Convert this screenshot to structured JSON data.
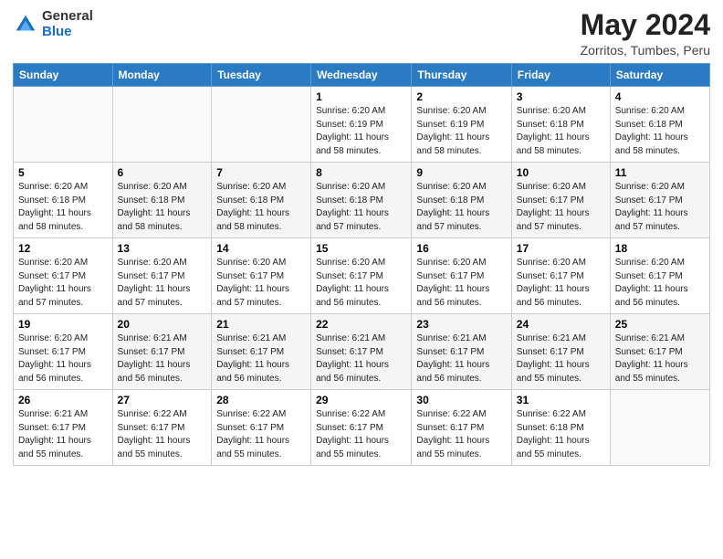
{
  "header": {
    "logo_general": "General",
    "logo_blue": "Blue",
    "title": "May 2024",
    "location": "Zorritos, Tumbes, Peru"
  },
  "days_of_week": [
    "Sunday",
    "Monday",
    "Tuesday",
    "Wednesday",
    "Thursday",
    "Friday",
    "Saturday"
  ],
  "weeks": [
    [
      {
        "day": "",
        "info": ""
      },
      {
        "day": "",
        "info": ""
      },
      {
        "day": "",
        "info": ""
      },
      {
        "day": "1",
        "info": "Sunrise: 6:20 AM\nSunset: 6:19 PM\nDaylight: 11 hours\nand 58 minutes."
      },
      {
        "day": "2",
        "info": "Sunrise: 6:20 AM\nSunset: 6:19 PM\nDaylight: 11 hours\nand 58 minutes."
      },
      {
        "day": "3",
        "info": "Sunrise: 6:20 AM\nSunset: 6:18 PM\nDaylight: 11 hours\nand 58 minutes."
      },
      {
        "day": "4",
        "info": "Sunrise: 6:20 AM\nSunset: 6:18 PM\nDaylight: 11 hours\nand 58 minutes."
      }
    ],
    [
      {
        "day": "5",
        "info": "Sunrise: 6:20 AM\nSunset: 6:18 PM\nDaylight: 11 hours\nand 58 minutes."
      },
      {
        "day": "6",
        "info": "Sunrise: 6:20 AM\nSunset: 6:18 PM\nDaylight: 11 hours\nand 58 minutes."
      },
      {
        "day": "7",
        "info": "Sunrise: 6:20 AM\nSunset: 6:18 PM\nDaylight: 11 hours\nand 58 minutes."
      },
      {
        "day": "8",
        "info": "Sunrise: 6:20 AM\nSunset: 6:18 PM\nDaylight: 11 hours\nand 57 minutes."
      },
      {
        "day": "9",
        "info": "Sunrise: 6:20 AM\nSunset: 6:18 PM\nDaylight: 11 hours\nand 57 minutes."
      },
      {
        "day": "10",
        "info": "Sunrise: 6:20 AM\nSunset: 6:17 PM\nDaylight: 11 hours\nand 57 minutes."
      },
      {
        "day": "11",
        "info": "Sunrise: 6:20 AM\nSunset: 6:17 PM\nDaylight: 11 hours\nand 57 minutes."
      }
    ],
    [
      {
        "day": "12",
        "info": "Sunrise: 6:20 AM\nSunset: 6:17 PM\nDaylight: 11 hours\nand 57 minutes."
      },
      {
        "day": "13",
        "info": "Sunrise: 6:20 AM\nSunset: 6:17 PM\nDaylight: 11 hours\nand 57 minutes."
      },
      {
        "day": "14",
        "info": "Sunrise: 6:20 AM\nSunset: 6:17 PM\nDaylight: 11 hours\nand 57 minutes."
      },
      {
        "day": "15",
        "info": "Sunrise: 6:20 AM\nSunset: 6:17 PM\nDaylight: 11 hours\nand 56 minutes."
      },
      {
        "day": "16",
        "info": "Sunrise: 6:20 AM\nSunset: 6:17 PM\nDaylight: 11 hours\nand 56 minutes."
      },
      {
        "day": "17",
        "info": "Sunrise: 6:20 AM\nSunset: 6:17 PM\nDaylight: 11 hours\nand 56 minutes."
      },
      {
        "day": "18",
        "info": "Sunrise: 6:20 AM\nSunset: 6:17 PM\nDaylight: 11 hours\nand 56 minutes."
      }
    ],
    [
      {
        "day": "19",
        "info": "Sunrise: 6:20 AM\nSunset: 6:17 PM\nDaylight: 11 hours\nand 56 minutes."
      },
      {
        "day": "20",
        "info": "Sunrise: 6:21 AM\nSunset: 6:17 PM\nDaylight: 11 hours\nand 56 minutes."
      },
      {
        "day": "21",
        "info": "Sunrise: 6:21 AM\nSunset: 6:17 PM\nDaylight: 11 hours\nand 56 minutes."
      },
      {
        "day": "22",
        "info": "Sunrise: 6:21 AM\nSunset: 6:17 PM\nDaylight: 11 hours\nand 56 minutes."
      },
      {
        "day": "23",
        "info": "Sunrise: 6:21 AM\nSunset: 6:17 PM\nDaylight: 11 hours\nand 56 minutes."
      },
      {
        "day": "24",
        "info": "Sunrise: 6:21 AM\nSunset: 6:17 PM\nDaylight: 11 hours\nand 55 minutes."
      },
      {
        "day": "25",
        "info": "Sunrise: 6:21 AM\nSunset: 6:17 PM\nDaylight: 11 hours\nand 55 minutes."
      }
    ],
    [
      {
        "day": "26",
        "info": "Sunrise: 6:21 AM\nSunset: 6:17 PM\nDaylight: 11 hours\nand 55 minutes."
      },
      {
        "day": "27",
        "info": "Sunrise: 6:22 AM\nSunset: 6:17 PM\nDaylight: 11 hours\nand 55 minutes."
      },
      {
        "day": "28",
        "info": "Sunrise: 6:22 AM\nSunset: 6:17 PM\nDaylight: 11 hours\nand 55 minutes."
      },
      {
        "day": "29",
        "info": "Sunrise: 6:22 AM\nSunset: 6:17 PM\nDaylight: 11 hours\nand 55 minutes."
      },
      {
        "day": "30",
        "info": "Sunrise: 6:22 AM\nSunset: 6:17 PM\nDaylight: 11 hours\nand 55 minutes."
      },
      {
        "day": "31",
        "info": "Sunrise: 6:22 AM\nSunset: 6:18 PM\nDaylight: 11 hours\nand 55 minutes."
      },
      {
        "day": "",
        "info": ""
      }
    ]
  ]
}
